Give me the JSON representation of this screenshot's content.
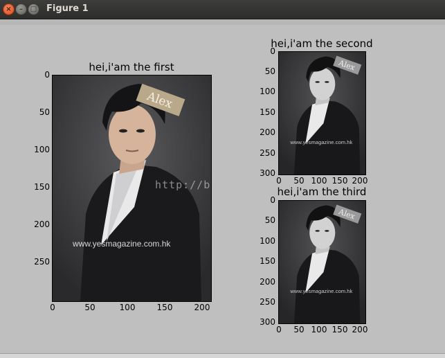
{
  "window": {
    "title": "Figure 1",
    "close_glyph": "×",
    "min_glyph": "–",
    "max_glyph": "□"
  },
  "watermark": "http://b",
  "subplots": [
    {
      "title": "hei,i'am the first",
      "image_watermark": "www.yesmagazine.com.hk",
      "logo_text": "Alex",
      "x_ticks": [
        "0",
        "50",
        "100",
        "150",
        "200"
      ],
      "y_ticks": [
        "0",
        "50",
        "100",
        "150",
        "200",
        "250"
      ]
    },
    {
      "title": "hei,i'am the second",
      "image_watermark": "www.yesmagazine.com.hk",
      "logo_text": "Alex",
      "x_ticks": [
        "0",
        "50",
        "100",
        "150",
        "200"
      ],
      "y_ticks": [
        "0",
        "50",
        "100",
        "150",
        "200",
        "250",
        "300"
      ]
    },
    {
      "title": "hei,i'am the third",
      "image_watermark": "www.yesmagazine.com.hk",
      "logo_text": "Alex",
      "x_ticks": [
        "0",
        "50",
        "100",
        "150",
        "200"
      ],
      "y_ticks": [
        "0",
        "50",
        "100",
        "150",
        "200",
        "250",
        "300"
      ]
    }
  ]
}
